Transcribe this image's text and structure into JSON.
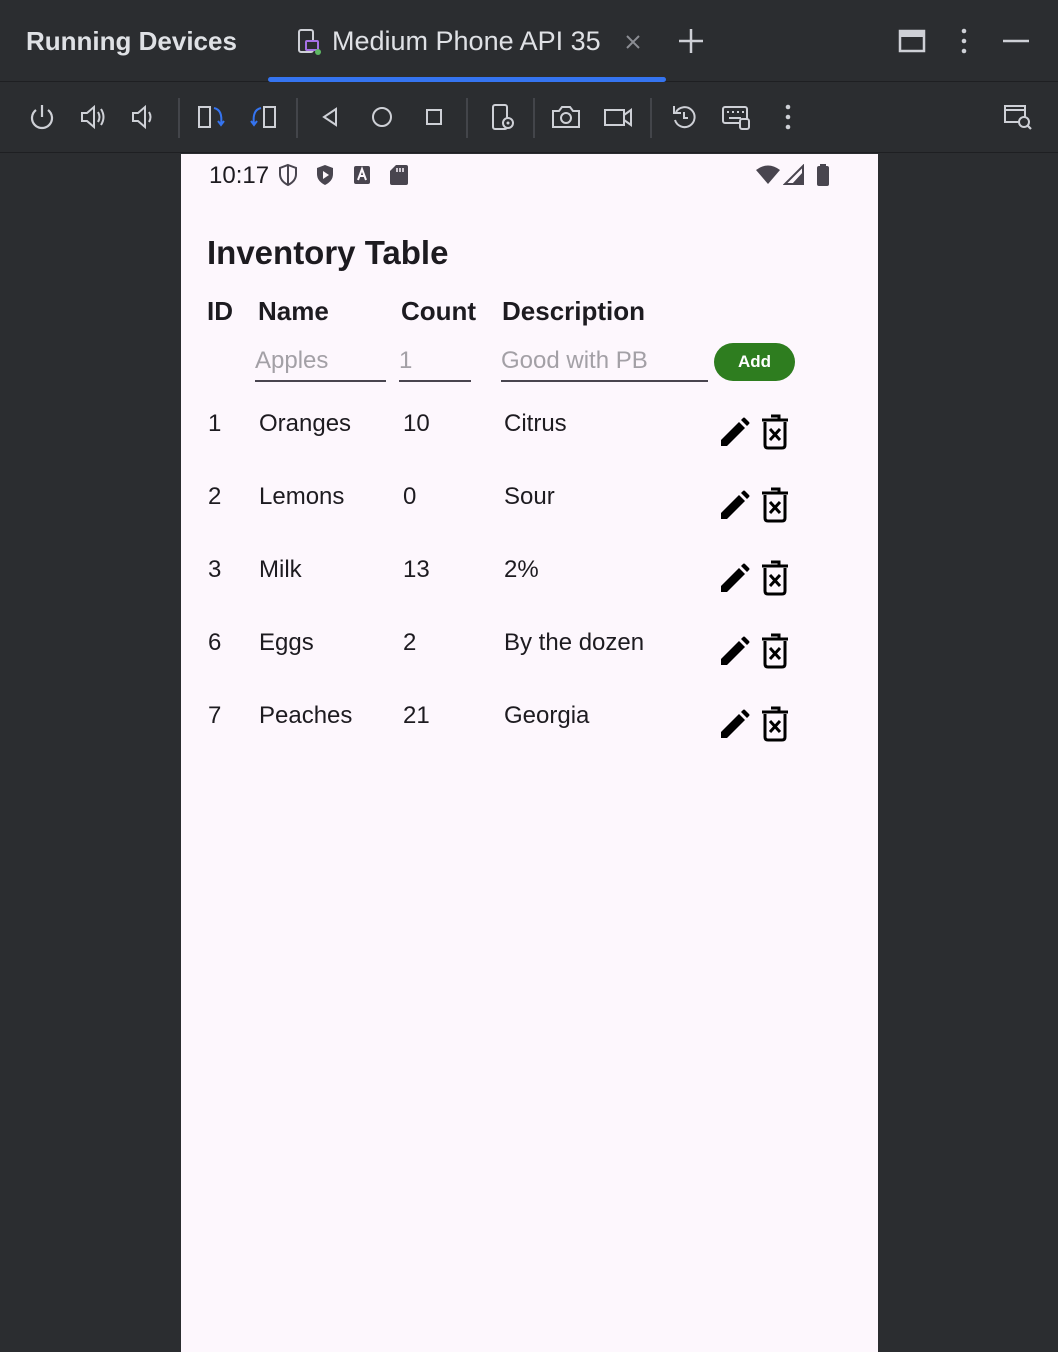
{
  "window": {
    "title": "Running Devices",
    "tab_label": "Medium Phone API 35"
  },
  "device": {
    "status_time": "10:17",
    "app_title": "Inventory Table",
    "headers": {
      "id": "ID",
      "name": "Name",
      "count": "Count",
      "description": "Description"
    },
    "inputs": {
      "name_placeholder": "Apples",
      "count_placeholder": "1",
      "description_placeholder": "Good with PB"
    },
    "add_label": "Add",
    "rows": [
      {
        "id": "1",
        "name": "Oranges",
        "count": "10",
        "description": "Citrus"
      },
      {
        "id": "2",
        "name": "Lemons",
        "count": "0",
        "description": "Sour"
      },
      {
        "id": "3",
        "name": "Milk",
        "count": "13",
        "description": "2%"
      },
      {
        "id": "6",
        "name": "Eggs",
        "count": "2",
        "description": "By the dozen"
      },
      {
        "id": "7",
        "name": "Peaches",
        "count": "21",
        "description": "Georgia"
      }
    ]
  },
  "toolbar_icons": [
    "power-icon",
    "volume-up-icon",
    "volume-down-icon",
    "rotate-left-icon",
    "rotate-right-icon",
    "back-icon",
    "home-icon",
    "overview-icon",
    "device-settings-icon",
    "screenshot-icon",
    "screen-record-icon",
    "reset-icon",
    "keyboard-icon",
    "more-icon",
    "inspect-icon"
  ],
  "colors": {
    "accent": "#3574f0",
    "add_button": "#2e7d1f",
    "screen_bg": "#fdf7fd",
    "ide_bg": "#2b2d30"
  }
}
